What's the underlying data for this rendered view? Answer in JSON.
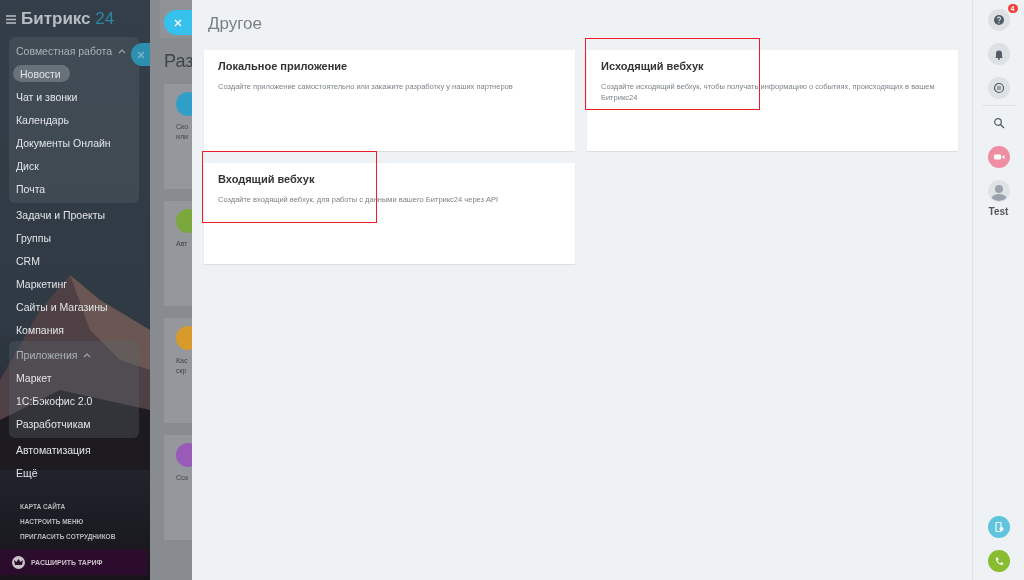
{
  "sidebar": {
    "logo": {
      "name": "Битрикс",
      "suffix": "24"
    },
    "sections": [
      {
        "kind": "group",
        "label": "Совместная работа",
        "expanded": true,
        "items": [
          {
            "label": "Новости",
            "selected": true
          },
          {
            "label": "Чат и звонки",
            "selected": false
          },
          {
            "label": "Календарь",
            "selected": false
          },
          {
            "label": "Документы Онлайн",
            "selected": false
          },
          {
            "label": "Диск",
            "selected": false
          },
          {
            "label": "Почта",
            "selected": false
          }
        ]
      },
      {
        "kind": "item",
        "label": "Задачи и Проекты",
        "selected": false
      },
      {
        "kind": "item",
        "label": "Группы",
        "selected": false
      },
      {
        "kind": "item",
        "label": "CRM",
        "selected": false
      },
      {
        "kind": "item",
        "label": "Маркетинг",
        "selected": false
      },
      {
        "kind": "item",
        "label": "Сайты и Магазины",
        "selected": false
      },
      {
        "kind": "item",
        "label": "Компания",
        "selected": false
      },
      {
        "kind": "group",
        "label": "Приложения",
        "expanded": true,
        "items": [
          {
            "label": "Маркет",
            "selected": false
          },
          {
            "label": "1С:Бэкофис 2.0",
            "selected": false
          },
          {
            "label": "Разработчикам",
            "selected": false
          }
        ]
      },
      {
        "kind": "item",
        "label": "Автоматизация",
        "selected": false
      },
      {
        "kind": "item",
        "label": "Ещё",
        "selected": false
      }
    ],
    "links": [
      "КАРТА САЙТА",
      "НАСТРОИТЬ МЕНЮ",
      "ПРИГЛАСИТЬ СОТРУДНИКОВ"
    ],
    "upgrade_button": "РАСШИРИТЬ ТАРИФ"
  },
  "background_page": {
    "title": "Раз",
    "cards": [
      {
        "lines": [
          "Ско",
          "или"
        ],
        "color": "#2f9fc9"
      },
      {
        "lines": [
          "Авт"
        ],
        "color": "#7aa83c"
      },
      {
        "lines": [
          "Кас",
          "скр"
        ],
        "color": "#d99a2c"
      },
      {
        "lines": [
          "Соз"
        ],
        "color": "#9a5bb8"
      }
    ]
  },
  "panel": {
    "title": "Другое",
    "cards": [
      {
        "title": "Локальное приложение",
        "description": "Создайте приложение самостоятельно или закажите разработку у наших партнеров",
        "highlighted": false
      },
      {
        "title": "Исходящий вебхук",
        "description": "Создайте исходящий вебхук, чтобы получать информацию о событиях, происходящих в вашем Битрикс24",
        "highlighted": true
      },
      {
        "title": "Входящий вебхук",
        "description": "Создайте входящий вебхук, для работы с данными вашего Битрикс24 через API",
        "highlighted": true
      }
    ]
  },
  "right_bar": {
    "notification_count": "4",
    "user_name": "Test"
  }
}
